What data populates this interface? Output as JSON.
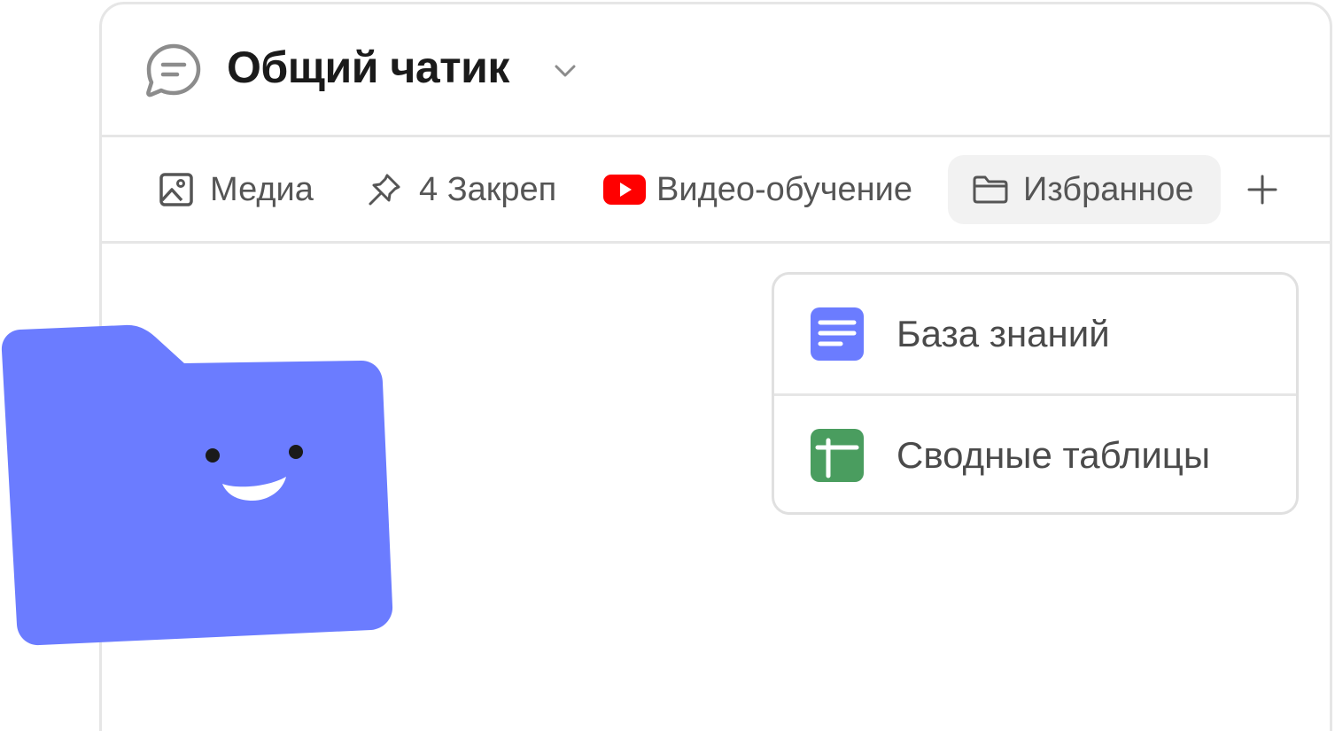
{
  "header": {
    "title": "Общий чатик",
    "chat_icon": "chat-bubble-icon",
    "chevron_icon": "chevron-down-icon"
  },
  "tabs": [
    {
      "label": "Медиа",
      "icon": "image-icon"
    },
    {
      "label": "4 Закреп",
      "icon": "pin-icon"
    },
    {
      "label": "Видео-обучение",
      "icon": "youtube-icon"
    },
    {
      "label": "Избранное",
      "icon": "folder-icon",
      "selected": true
    }
  ],
  "add_tab_icon": "plus-icon",
  "dropdown": {
    "items": [
      {
        "label": "База знаний",
        "icon": "document-icon",
        "color": "#6b7cff"
      },
      {
        "label": "Сводные таблицы",
        "icon": "table-icon",
        "color": "#4a9d5f"
      }
    ]
  },
  "colors": {
    "mascot_folder": "#6b7cff",
    "youtube_red": "#ff0000",
    "selected_tab_bg": "#f2f2f2"
  },
  "decoration": {
    "mascot": "smiling-folder-mascot"
  }
}
